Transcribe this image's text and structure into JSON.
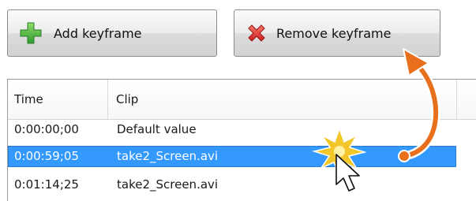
{
  "toolbar": {
    "add_label": "Add keyframe",
    "add_icon": "green-plus-icon",
    "remove_label": "Remove keyframe",
    "remove_icon": "red-x-icon"
  },
  "table": {
    "columns": [
      "Time",
      "Clip"
    ],
    "rows": [
      {
        "time": "0:00:00;00",
        "clip": "Default value",
        "selected": false
      },
      {
        "time": "0:00:59;05",
        "clip": "take2_Screen.avi",
        "selected": true
      },
      {
        "time": "0:01:14;25",
        "clip": "take2_Screen.avi",
        "selected": false
      }
    ]
  },
  "annotation": {
    "arrow_icon": "curved-arrow-icon",
    "click_icon": "click-burst-icon",
    "cursor_icon": "mouse-pointer-icon"
  },
  "colors": {
    "selection": "#3399ff",
    "arrow": "#e8701c",
    "burst": "#f3c72a",
    "add_icon": "#3aa83a",
    "remove_icon": "#e53935"
  }
}
